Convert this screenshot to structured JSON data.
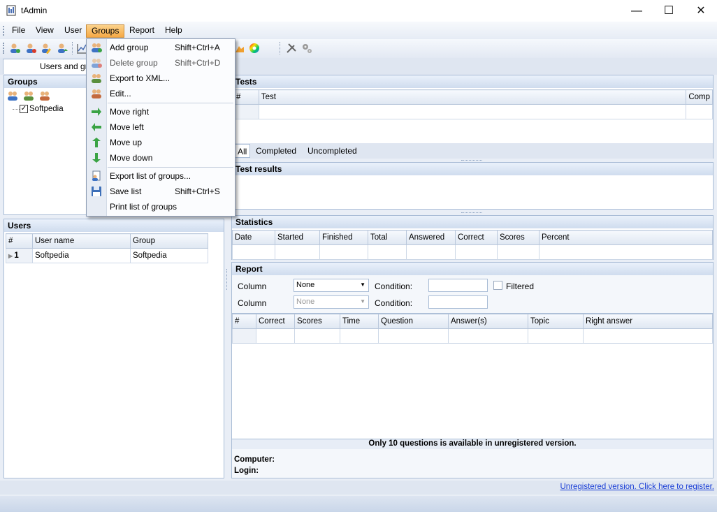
{
  "window": {
    "title": "tAdmin",
    "minimize_glyph": "—",
    "maximize_glyph": "☐",
    "close_glyph": "✕"
  },
  "menubar": {
    "items": [
      "File",
      "View",
      "User",
      "Groups",
      "Report",
      "Help"
    ],
    "active": "Groups"
  },
  "tabs": {
    "users_and_groups": "Users and gr"
  },
  "groups_menu": {
    "items": [
      {
        "label": "Add group",
        "shortcut": "Shift+Ctrl+A",
        "icon": "add-group-icon"
      },
      {
        "label": "Delete group",
        "shortcut": "Shift+Ctrl+D",
        "icon": "delete-group-icon",
        "disabled": true
      },
      {
        "label": "Export to XML...",
        "shortcut": "",
        "icon": "export-xml-icon"
      },
      {
        "label": "Edit...",
        "shortcut": "",
        "icon": "edit-group-icon"
      },
      {
        "label": "Move right",
        "shortcut": "",
        "icon": "arrow-right-icon"
      },
      {
        "label": "Move left",
        "shortcut": "",
        "icon": "arrow-left-icon"
      },
      {
        "label": "Move up",
        "shortcut": "",
        "icon": "arrow-up-icon"
      },
      {
        "label": "Move down",
        "shortcut": "",
        "icon": "arrow-down-icon"
      },
      {
        "label": "Export list of groups...",
        "shortcut": "",
        "icon": "export-list-icon"
      },
      {
        "label": "Save list",
        "shortcut": "Shift+Ctrl+S",
        "icon": "save-icon"
      },
      {
        "label": "Print list of groups",
        "shortcut": "",
        "icon": ""
      }
    ]
  },
  "groups_panel": {
    "title": "Groups",
    "tree_item": "Softpedia",
    "checked": true
  },
  "users_panel": {
    "title": "Users",
    "columns": [
      "#",
      "User name",
      "Group"
    ],
    "rows": [
      {
        "num": "1",
        "user_name": "Softpedia",
        "group": "Softpedia"
      }
    ]
  },
  "tests_panel": {
    "title": "Tests",
    "columns": [
      "#",
      "Test",
      "Comp"
    ],
    "filter_tabs": [
      "All",
      "Completed",
      "Uncompleted"
    ]
  },
  "test_results": {
    "title": "Test results"
  },
  "statistics": {
    "title": "Statistics",
    "columns": [
      "Date",
      "Started",
      "Finished",
      "Total",
      "Answered",
      "Correct",
      "Scores",
      "Percent"
    ]
  },
  "report": {
    "title": "Report",
    "column_label": "Column",
    "condition_label": "Condition:",
    "combo1_value": "None",
    "combo2_value": "None",
    "filtered_label": "Filtered",
    "columns": [
      "#",
      "Correct",
      "Scores",
      "Time",
      "Question",
      "Answer(s)",
      "Topic",
      "Right answer"
    ],
    "notice": "Only 10 questions is available in unregistered version.",
    "computer_label": "Computer:",
    "login_label": "Login:"
  },
  "status": {
    "register_link": "Unregistered version. Click here to register."
  },
  "colors": {
    "panel_header": "#cfdcee",
    "menu_active": "#f6a946",
    "link": "#1a3ed6"
  }
}
